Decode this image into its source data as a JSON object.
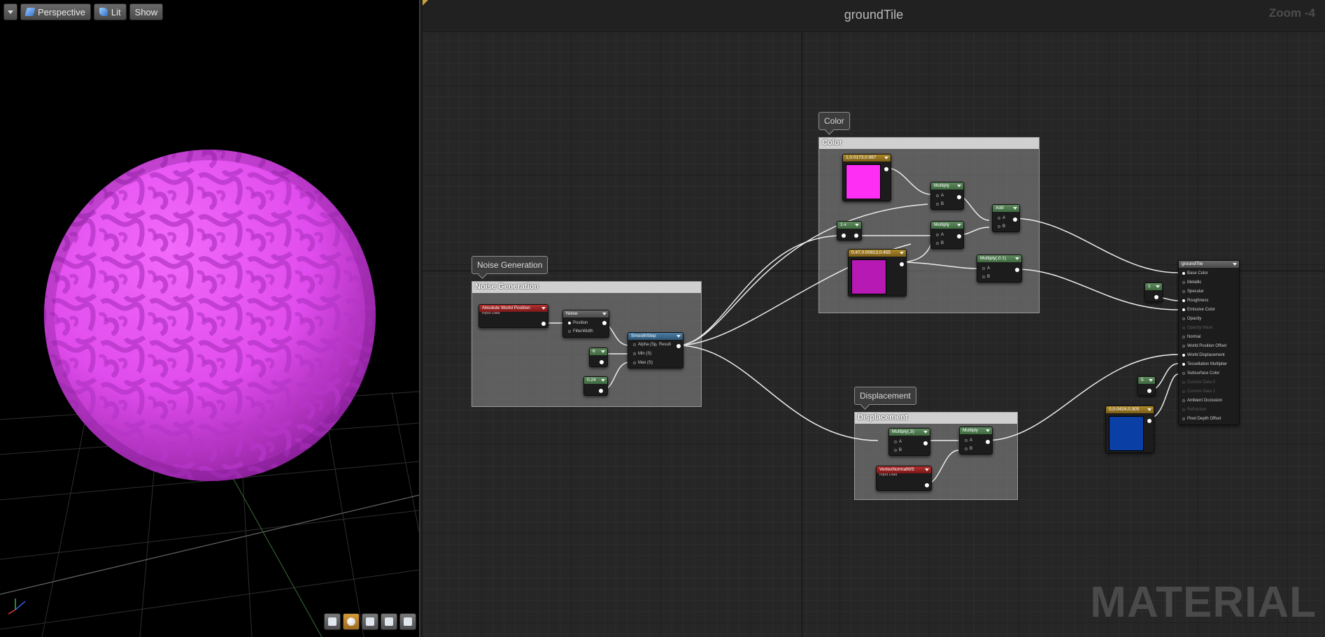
{
  "viewport": {
    "toolbar": {
      "menu_icon": "caret-down-icon",
      "perspective_label": "Perspective",
      "lit_label": "Lit",
      "show_label": "Show"
    },
    "sphere_color": "#e44ef2",
    "bottom_tools": [
      "cylinder-icon",
      "sphere-icon",
      "plane-icon",
      "cube-icon",
      "teapot-icon"
    ]
  },
  "graph": {
    "title": "groundTile",
    "zoom": "Zoom -4",
    "watermark": "MATERIAL",
    "comments": {
      "noise": {
        "bubble": "Noise Generation",
        "header": "Noise Generation"
      },
      "color": {
        "bubble": "Color",
        "header": "Color"
      },
      "displacement": {
        "bubble": "Displacement",
        "header": "Displacement"
      }
    },
    "nodes": {
      "abs_world_pos": {
        "title": "Absolute World Position",
        "subtitle": "Input Data"
      },
      "noise": {
        "title": "Noise",
        "pins": [
          "Position",
          "FilterWidth"
        ]
      },
      "const_6": {
        "title": "6"
      },
      "const_024": {
        "title": "0.24"
      },
      "smoothstep": {
        "title": "SmoothStep",
        "pins": [
          "Alpha (S)",
          "Min (S)",
          "Max (S)"
        ],
        "output": "Result"
      },
      "color1": {
        "title": "1,0.0173,0.987",
        "color": "#ff2ef5"
      },
      "const_1minus": {
        "title": "1-x"
      },
      "color2": {
        "title": "0.47,0.00813,0.455",
        "color": "#b71ab4"
      },
      "multiply1": {
        "title": "Multiply",
        "pins": [
          "A",
          "B"
        ]
      },
      "multiply2": {
        "title": "Multiply",
        "pins": [
          "A",
          "B"
        ]
      },
      "add": {
        "title": "Add",
        "pins": [
          "A",
          "B"
        ]
      },
      "multiply01": {
        "title": "Multiply(,0.1)",
        "pins": [
          "A",
          "B"
        ]
      },
      "const_1": {
        "title": "1"
      },
      "multiply3": {
        "title": "Multiply(,3)",
        "pins": [
          "A",
          "B"
        ]
      },
      "vertex_normal": {
        "title": "VertexNormalWS",
        "subtitle": "Input Data"
      },
      "multiply4": {
        "title": "Multiply",
        "pins": [
          "A",
          "B"
        ]
      },
      "const_5": {
        "title": "5"
      },
      "color3": {
        "title": "0,0.0424,0.305",
        "color": "#0a3fa6"
      },
      "result": {
        "title": "groundTile",
        "pins": [
          {
            "label": "Base Color",
            "active": true
          },
          {
            "label": "Metallic",
            "active": false
          },
          {
            "label": "Specular",
            "active": false
          },
          {
            "label": "Roughness",
            "active": true
          },
          {
            "label": "Emissive Color",
            "active": true
          },
          {
            "label": "Opacity",
            "active": false
          },
          {
            "label": "Opacity Mask",
            "active": false,
            "dim": true
          },
          {
            "label": "Normal",
            "active": false
          },
          {
            "label": "World Position Offset",
            "active": false
          },
          {
            "label": "World Displacement",
            "active": true
          },
          {
            "label": "Tessellation Multiplier",
            "active": true
          },
          {
            "label": "Subsurface Color",
            "active": false
          },
          {
            "label": "Custom Data 0",
            "active": false,
            "dim": true
          },
          {
            "label": "Custom Data 1",
            "active": false,
            "dim": true
          },
          {
            "label": "Ambient Occlusion",
            "active": false
          },
          {
            "label": "Refraction",
            "active": false,
            "dim": true
          },
          {
            "label": "Pixel Depth Offset",
            "active": false
          }
        ]
      }
    }
  }
}
